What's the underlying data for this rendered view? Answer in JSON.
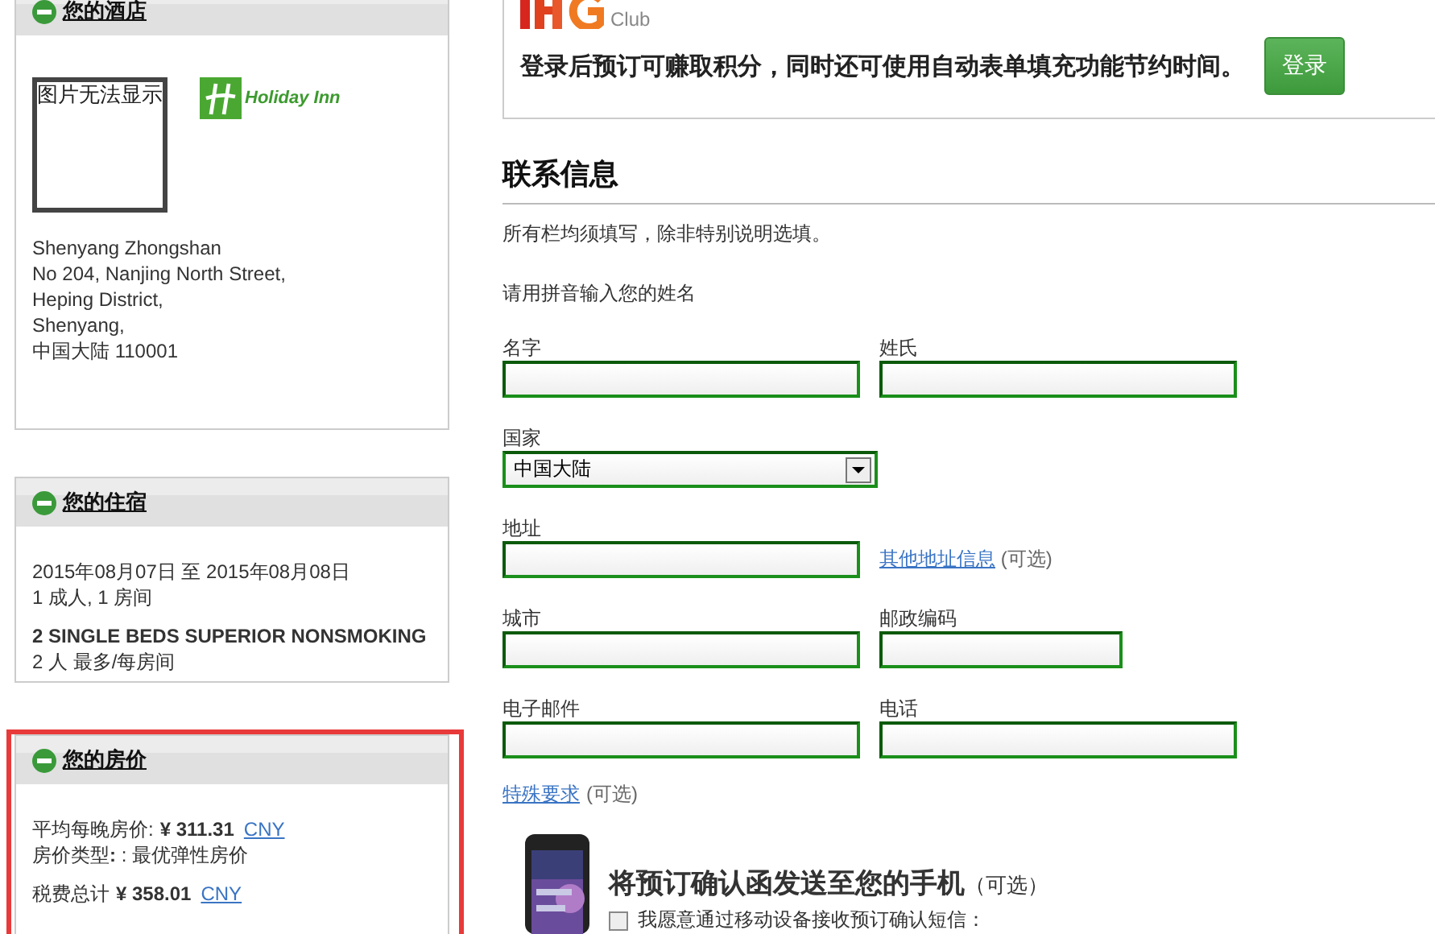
{
  "hotel_panel": {
    "title": "您的酒店",
    "expanded": true,
    "image_placeholder": "图片无法显示",
    "brand": "Holiday Inn",
    "address_lines": [
      "Shenyang Zhongshan",
      "No 204, Nanjing North Street,",
      "Heping District,",
      "Shenyang,",
      "中国大陆   110001"
    ]
  },
  "stay_panel": {
    "title": "您的住宿",
    "expanded": true,
    "dates": "2015年08月07日  至  2015年08月08日",
    "guests": "1 成人, 1 房间",
    "room_type": "2 SINGLE BEDS SUPERIOR NONSMOKING",
    "occupancy": "2 人 最多/每房间"
  },
  "price_panel": {
    "title": "您的房价",
    "expanded": true,
    "highlighted": true,
    "avg_label": "平均每晚房价:",
    "avg_amount": "¥  311.31",
    "avg_currency": "CNY",
    "rate_type": "房价类型**:** : 最优弹性房价",
    "total_label": "税费总计",
    "total_amount": "¥  358.01",
    "total_currency": "CNY"
  },
  "login_box": {
    "program_suffix": "Club",
    "message": "登录后预订可赚取积分，同时还可使用自动表单填充功能节约时间。",
    "button": "登录"
  },
  "contact": {
    "heading": "联系信息",
    "note": "所有栏均须填写，除非特别说明选填。",
    "name_hint": "请用拼音输入您的姓名",
    "rows": [
      [
        {
          "kind": "text",
          "label": "名字"
        },
        {
          "kind": "text",
          "label": "姓氏"
        }
      ],
      [
        {
          "kind": "select",
          "label": "国家",
          "value": "中国大陆"
        }
      ],
      [
        {
          "kind": "text",
          "label": "地址"
        },
        {
          "kind": "link",
          "link": "其他地址信息",
          "suffix": "(可选)"
        }
      ],
      [
        {
          "kind": "text",
          "label": "城市"
        },
        {
          "kind": "short",
          "label": "邮政编码"
        }
      ],
      [
        {
          "kind": "text",
          "label": "电子邮件"
        },
        {
          "kind": "text",
          "label": "电话"
        }
      ]
    ],
    "special_request": {
      "link": "特殊要求",
      "suffix": "(可选)"
    }
  },
  "sms": {
    "title": "将预订确认函发送至您的手机",
    "suffix": "（可选）",
    "checkbox_label": "我愿意通过移动设备接收预订确认短信：",
    "checked": false
  }
}
